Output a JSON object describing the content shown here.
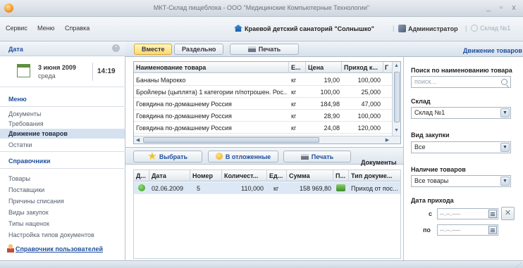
{
  "window": {
    "title": "МКТ-Склад пищеблока - ООО \"Медицинские Компьютерные Технологии\"",
    "minimize": "_",
    "maximize": "▫",
    "close": "x"
  },
  "menu": {
    "items": [
      "Сервис",
      "Меню",
      "Справка"
    ],
    "organization": "Краевой детский санаторий \"Солнышко\"",
    "user": "Администратор",
    "warehouse": "Склад №1"
  },
  "sidebar": {
    "date_header": "Дата",
    "date": "3 июня 2009",
    "weekday": "среда",
    "time": "14:19",
    "menu_header": "Меню",
    "menu_items": [
      "Документы",
      "Требования",
      "Движение товаров",
      "Остатки"
    ],
    "active_item": "Движение товаров",
    "ref_header": "Справочники",
    "ref_items": [
      "Товары",
      "Поставщики",
      "Причины списания",
      "Виды закупок",
      "Типы наценок",
      "Настройка типов документов"
    ],
    "user_link": "Справочник пользователей"
  },
  "tabs": {
    "together": "Вместе",
    "separate": "Раздельно",
    "print": "Печать"
  },
  "panel_title": "Движение товаров",
  "goods_table": {
    "columns": [
      "Наименование товара",
      "Е...",
      "Цена",
      "Приход к...",
      "Г"
    ],
    "rows": [
      [
        "Бананы Марокко",
        "кг",
        "19,00",
        "100,000"
      ],
      [
        "Бройлеры (цыплята) 1 категории п/потрошен. Рос...",
        "кг",
        "100,00",
        "25,000"
      ],
      [
        "Говядина по-домашнему Россия",
        "кг",
        "184,98",
        "47,000"
      ],
      [
        "Говядина по-домашнему Россия",
        "кг",
        "28,90",
        "100,000"
      ],
      [
        "Говядина по-домашнему Россия",
        "кг",
        "24,08",
        "120,000"
      ]
    ]
  },
  "doc_buttons": {
    "select": "Выбрать",
    "deferred": "В отложенные",
    "print": "Печать",
    "documents_label": "Документы"
  },
  "docs_table": {
    "columns": [
      "Д...",
      "Дата",
      "Номер",
      "Количест...",
      "Ед...",
      "Сумма",
      "П...",
      "Тип докуме..."
    ],
    "rows": [
      [
        "02.06.2009",
        "5",
        "110,000",
        "кг",
        "158 969,80",
        "Приход от пос..."
      ]
    ]
  },
  "filters": {
    "search_label": "Поиск по наименованию товара",
    "search_placeholder": "поиск...",
    "warehouse_label": "Склад",
    "warehouse_value": "Склад №1",
    "purchase_label": "Вид закупки",
    "purchase_value": "Все",
    "stock_label": "Наличие товаров",
    "stock_value": "Все товары",
    "date_label": "Дата прихода",
    "from_label": "с",
    "to_label": "по",
    "from_value": "--.--.----",
    "to_value": "--.--.----"
  },
  "colors": {
    "accent_blue": "#1f4f9c",
    "active_tab": "#ffd86a",
    "selected_row": "#dce8f5",
    "status_green": "#3cae2a"
  }
}
